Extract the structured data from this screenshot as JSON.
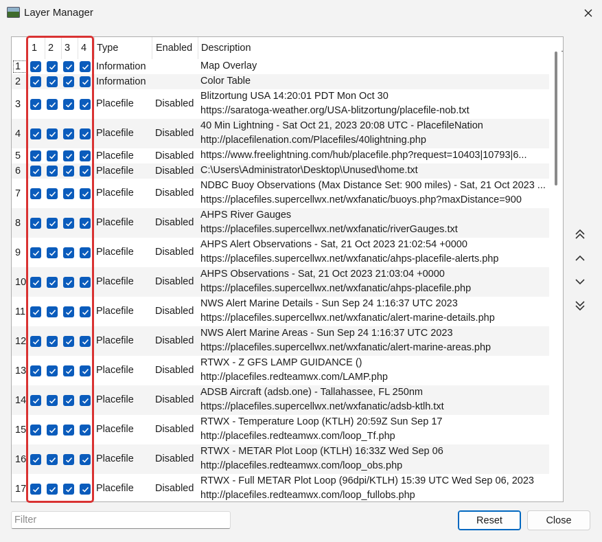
{
  "window": {
    "title": "Layer Manager",
    "close_glyph": "✕"
  },
  "columns": {
    "c1": "1",
    "c2": "2",
    "c3": "3",
    "c4": "4",
    "type": "Type",
    "enabled": "Enabled",
    "description": "Description"
  },
  "rows": [
    {
      "num": "1",
      "checks": [
        true,
        true,
        true,
        true
      ],
      "type": "Information",
      "enabled": "",
      "desc1": "Map Overlay",
      "desc2": ""
    },
    {
      "num": "2",
      "checks": [
        true,
        true,
        true,
        true
      ],
      "type": "Information",
      "enabled": "",
      "desc1": "Color Table",
      "desc2": ""
    },
    {
      "num": "3",
      "checks": [
        true,
        true,
        true,
        true
      ],
      "type": "Placefile",
      "enabled": "Disabled",
      "desc1": "Blitzortung USA 14:20:01 PDT Mon Oct 30",
      "desc2": "https://saratoga-weather.org/USA-blitzortung/placefile-nob.txt"
    },
    {
      "num": "4",
      "checks": [
        true,
        true,
        true,
        true
      ],
      "type": "Placefile",
      "enabled": "Disabled",
      "desc1": "40 Min Lightning - Sat Oct 21, 2023 20:08 UTC - PlacefileNation",
      "desc2": "http://placefilenation.com/Placefiles/40lightning.php"
    },
    {
      "num": "5",
      "checks": [
        true,
        true,
        true,
        true
      ],
      "type": "Placefile",
      "enabled": "Disabled",
      "desc1": "https://www.freelightning.com/hub/placefile.php?request=10403|10793|6...",
      "desc2": ""
    },
    {
      "num": "6",
      "checks": [
        true,
        true,
        true,
        true
      ],
      "type": "Placefile",
      "enabled": "Disabled",
      "desc1": "C:\\Users\\Administrator\\Desktop\\Unused\\home.txt",
      "desc2": ""
    },
    {
      "num": "7",
      "checks": [
        true,
        true,
        true,
        true
      ],
      "type": "Placefile",
      "enabled": "Disabled",
      "desc1": "NDBC Buoy Observations (Max Distance Set: 900 miles) - Sat, 21 Oct 2023 ...",
      "desc2": "https://placefiles.supercellwx.net/wxfanatic/buoys.php?maxDistance=900"
    },
    {
      "num": "8",
      "checks": [
        true,
        true,
        true,
        true
      ],
      "type": "Placefile",
      "enabled": "Disabled",
      "desc1": "AHPS River Gauges",
      "desc2": "https://placefiles.supercellwx.net/wxfanatic/riverGauges.txt"
    },
    {
      "num": "9",
      "checks": [
        true,
        true,
        true,
        true
      ],
      "type": "Placefile",
      "enabled": "Disabled",
      "desc1": "AHPS Alert Observations - Sat, 21 Oct 2023 21:02:54 +0000",
      "desc2": "https://placefiles.supercellwx.net/wxfanatic/ahps-placefile-alerts.php"
    },
    {
      "num": "10",
      "checks": [
        true,
        true,
        true,
        true
      ],
      "type": "Placefile",
      "enabled": "Disabled",
      "desc1": "AHPS Observations - Sat, 21 Oct 2023 21:03:04 +0000",
      "desc2": "https://placefiles.supercellwx.net/wxfanatic/ahps-placefile.php"
    },
    {
      "num": "11",
      "checks": [
        true,
        true,
        true,
        true
      ],
      "type": "Placefile",
      "enabled": "Disabled",
      "desc1": "NWS Alert Marine Details - Sun Sep 24 1:16:37 UTC 2023",
      "desc2": "https://placefiles.supercellwx.net/wxfanatic/alert-marine-details.php"
    },
    {
      "num": "12",
      "checks": [
        true,
        true,
        true,
        true
      ],
      "type": "Placefile",
      "enabled": "Disabled",
      "desc1": "NWS Alert Marine Areas - Sun Sep 24 1:16:37 UTC 2023",
      "desc2": "https://placefiles.supercellwx.net/wxfanatic/alert-marine-areas.php"
    },
    {
      "num": "13",
      "checks": [
        true,
        true,
        true,
        true
      ],
      "type": "Placefile",
      "enabled": "Disabled",
      "desc1": "RTWX - Z GFS LAMP GUIDANCE ()",
      "desc2": "http://placefiles.redteamwx.com/LAMP.php"
    },
    {
      "num": "14",
      "checks": [
        true,
        true,
        true,
        true
      ],
      "type": "Placefile",
      "enabled": "Disabled",
      "desc1": "ADSB Aircraft (adsb.one) - Tallahassee, FL 250nm",
      "desc2": "https://placefiles.supercellwx.net/wxfanatic/adsb-ktlh.txt"
    },
    {
      "num": "15",
      "checks": [
        true,
        true,
        true,
        true
      ],
      "type": "Placefile",
      "enabled": "Disabled",
      "desc1": "RTWX - Temperature Loop (KTLH) 20:59Z Sun Sep 17",
      "desc2": "http://placefiles.redteamwx.com/loop_Tf.php"
    },
    {
      "num": "16",
      "checks": [
        true,
        true,
        true,
        true
      ],
      "type": "Placefile",
      "enabled": "Disabled",
      "desc1": "RTWX - METAR Plot Loop (KTLH) 16:33Z Wed Sep 06",
      "desc2": "http://placefiles.redteamwx.com/loop_obs.php"
    },
    {
      "num": "17",
      "checks": [
        true,
        true,
        true,
        true
      ],
      "type": "Placefile",
      "enabled": "Disabled",
      "desc1": "RTWX - Full METAR Plot Loop (96dpi/KTLH) 15:39 UTC Wed Sep 06, 2023",
      "desc2": "http://placefiles.redteamwx.com/loop_fullobs.php"
    }
  ],
  "nav": {
    "top": "double-chevron-up-icon",
    "up": "chevron-up-icon",
    "down": "chevron-down-icon",
    "bottom": "double-chevron-down-icon"
  },
  "filter": {
    "placeholder": "Filter",
    "value": ""
  },
  "buttons": {
    "reset": "Reset",
    "close": "Close"
  },
  "colors": {
    "checkbox": "#0b5cbc",
    "highlight": "#d93232",
    "accent": "#0067c0"
  }
}
